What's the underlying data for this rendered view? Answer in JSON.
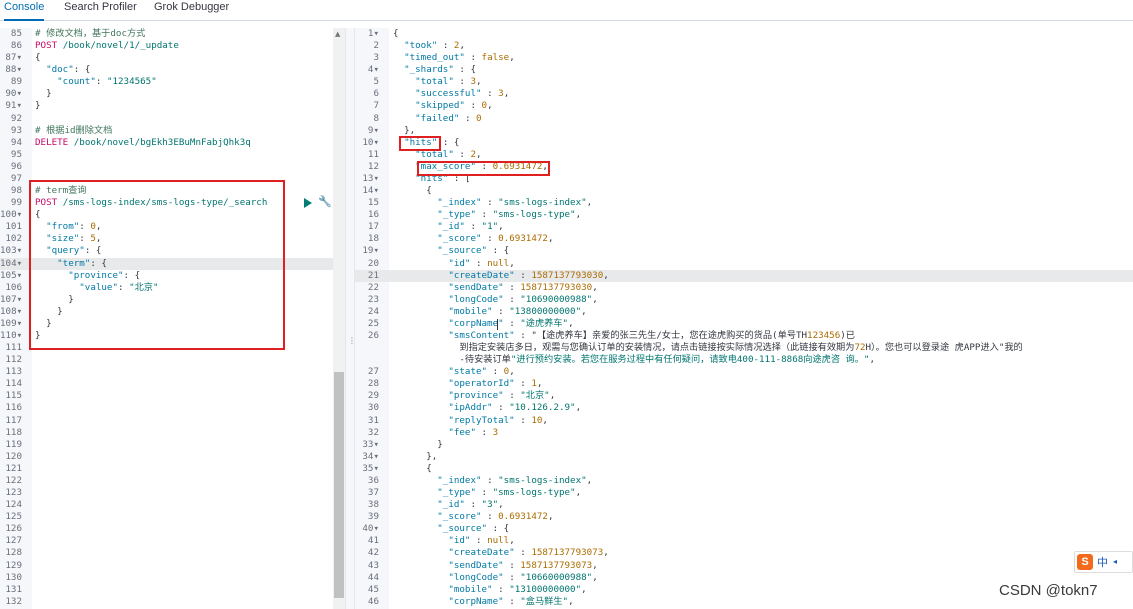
{
  "tabs": [
    {
      "label": "Console",
      "active": true
    },
    {
      "label": "Search Profiler",
      "active": false
    },
    {
      "label": "Grok Debugger",
      "active": false
    }
  ],
  "colors": {
    "accent": "#006bb4",
    "highlight_box": "#e02020",
    "method": "#c80a68",
    "string": "#00756f",
    "key": "#0079a5",
    "comment": "#41755c"
  },
  "icons": [
    "play-icon",
    "wrench-icon",
    "scroll-up-arrow",
    "sogou-ime-logo"
  ],
  "left_editor": {
    "lines": [
      {
        "n": "85",
        "fold": false,
        "text": "# 修改文档，基于doc方式"
      },
      {
        "n": "86",
        "fold": false,
        "text": "POST /book/novel/1/_update"
      },
      {
        "n": "87",
        "fold": true,
        "text": "{"
      },
      {
        "n": "88",
        "fold": true,
        "text": "  \"doc\": {"
      },
      {
        "n": "89",
        "fold": false,
        "text": "    \"count\": \"1234565\""
      },
      {
        "n": "90",
        "fold": true,
        "text": "  }"
      },
      {
        "n": "91",
        "fold": true,
        "text": "}"
      },
      {
        "n": "92",
        "fold": false,
        "text": ""
      },
      {
        "n": "93",
        "fold": false,
        "text": "# 根据id删除文档"
      },
      {
        "n": "94",
        "fold": false,
        "text": "DELETE /book/novel/bgEkh3EBuMnFabjQhk3q"
      },
      {
        "n": "95",
        "fold": false,
        "text": ""
      },
      {
        "n": "96",
        "fold": false,
        "text": ""
      },
      {
        "n": "97",
        "fold": false,
        "text": ""
      },
      {
        "n": "98",
        "fold": false,
        "text": "# term查询"
      },
      {
        "n": "99",
        "fold": false,
        "text": "POST /sms-logs-index/sms-logs-type/_search"
      },
      {
        "n": "100",
        "fold": true,
        "text": "{"
      },
      {
        "n": "101",
        "fold": false,
        "text": "  \"from\": 0,"
      },
      {
        "n": "102",
        "fold": false,
        "text": "  \"size\": 5,"
      },
      {
        "n": "103",
        "fold": true,
        "text": "  \"query\": {"
      },
      {
        "n": "104",
        "fold": true,
        "text": "    \"term\": {"
      },
      {
        "n": "105",
        "fold": true,
        "text": "      \"province\": {"
      },
      {
        "n": "106",
        "fold": false,
        "text": "        \"value\": \"北京\""
      },
      {
        "n": "107",
        "fold": true,
        "text": "      }"
      },
      {
        "n": "108",
        "fold": true,
        "text": "    }"
      },
      {
        "n": "109",
        "fold": true,
        "text": "  }"
      },
      {
        "n": "110",
        "fold": true,
        "text": "}"
      },
      {
        "n": "111",
        "fold": false,
        "text": ""
      },
      {
        "n": "112",
        "fold": false,
        "text": ""
      },
      {
        "n": "113",
        "fold": false,
        "text": ""
      },
      {
        "n": "114",
        "fold": false,
        "text": ""
      },
      {
        "n": "115",
        "fold": false,
        "text": ""
      },
      {
        "n": "116",
        "fold": false,
        "text": ""
      },
      {
        "n": "117",
        "fold": false,
        "text": ""
      },
      {
        "n": "118",
        "fold": false,
        "text": ""
      },
      {
        "n": "119",
        "fold": false,
        "text": ""
      },
      {
        "n": "120",
        "fold": false,
        "text": ""
      },
      {
        "n": "121",
        "fold": false,
        "text": ""
      },
      {
        "n": "122",
        "fold": false,
        "text": ""
      },
      {
        "n": "123",
        "fold": false,
        "text": ""
      },
      {
        "n": "124",
        "fold": false,
        "text": ""
      },
      {
        "n": "125",
        "fold": false,
        "text": ""
      },
      {
        "n": "126",
        "fold": false,
        "text": ""
      },
      {
        "n": "127",
        "fold": false,
        "text": ""
      },
      {
        "n": "128",
        "fold": false,
        "text": ""
      },
      {
        "n": "129",
        "fold": false,
        "text": ""
      },
      {
        "n": "130",
        "fold": false,
        "text": ""
      },
      {
        "n": "131",
        "fold": false,
        "text": ""
      },
      {
        "n": "132",
        "fold": false,
        "text": ""
      }
    ]
  },
  "right_editor": {
    "lines": [
      {
        "n": "1",
        "fold": true,
        "text": "{"
      },
      {
        "n": "2",
        "fold": false,
        "text": "  \"took\" : 2,"
      },
      {
        "n": "3",
        "fold": false,
        "text": "  \"timed_out\" : false,"
      },
      {
        "n": "4",
        "fold": true,
        "text": "  \"_shards\" : {"
      },
      {
        "n": "5",
        "fold": false,
        "text": "    \"total\" : 3,"
      },
      {
        "n": "6",
        "fold": false,
        "text": "    \"successful\" : 3,"
      },
      {
        "n": "7",
        "fold": false,
        "text": "    \"skipped\" : 0,"
      },
      {
        "n": "8",
        "fold": false,
        "text": "    \"failed\" : 0"
      },
      {
        "n": "9",
        "fold": true,
        "text": "  },"
      },
      {
        "n": "10",
        "fold": true,
        "text": "  \"hits\" : {"
      },
      {
        "n": "11",
        "fold": false,
        "text": "    \"total\" : 2,"
      },
      {
        "n": "12",
        "fold": false,
        "text": "    \"max_score\" : 0.6931472,"
      },
      {
        "n": "13",
        "fold": true,
        "text": "    \"hits\" : ["
      },
      {
        "n": "14",
        "fold": true,
        "text": "      {"
      },
      {
        "n": "15",
        "fold": false,
        "text": "        \"_index\" : \"sms-logs-index\","
      },
      {
        "n": "16",
        "fold": false,
        "text": "        \"_type\" : \"sms-logs-type\","
      },
      {
        "n": "17",
        "fold": false,
        "text": "        \"_id\" : \"1\","
      },
      {
        "n": "18",
        "fold": false,
        "text": "        \"_score\" : 0.6931472,"
      },
      {
        "n": "19",
        "fold": true,
        "text": "        \"_source\" : {"
      },
      {
        "n": "20",
        "fold": false,
        "text": "          \"id\" : null,"
      },
      {
        "n": "21",
        "fold": false,
        "text": "          \"createDate\" : 1587137793030,"
      },
      {
        "n": "22",
        "fold": false,
        "text": "          \"sendDate\" : 1587137793030,"
      },
      {
        "n": "23",
        "fold": false,
        "text": "          \"longCode\" : \"10690000988\","
      },
      {
        "n": "24",
        "fold": false,
        "text": "          \"mobile\" : \"13800000000\","
      },
      {
        "n": "25",
        "fold": false,
        "text": "          \"corpName\" : \"途虎养车\","
      },
      {
        "n": "26",
        "fold": false,
        "text": "          \"smsContent\" : \"【途虎养车】亲爱的张三先生/女士，您在途虎购买的货品(单号TH123456)已"
      },
      {
        "n": "",
        "fold": false,
        "text": "            到指定安装店多日，观需与您确认订单的安装情况，请点击链接按实际情况选择（此链接有效期为72H）。您也可以登录途 虎APP进入\"我的"
      },
      {
        "n": "",
        "fold": false,
        "text": "            -待安装订单\"进行预约安装。若您在服务过程中有任何疑问，请致电400-111-8868向途虎咨 询。\","
      },
      {
        "n": "27",
        "fold": false,
        "text": "          \"state\" : 0,"
      },
      {
        "n": "28",
        "fold": false,
        "text": "          \"operatorId\" : 1,"
      },
      {
        "n": "29",
        "fold": false,
        "text": "          \"province\" : \"北京\","
      },
      {
        "n": "30",
        "fold": false,
        "text": "          \"ipAddr\" : \"10.126.2.9\","
      },
      {
        "n": "31",
        "fold": false,
        "text": "          \"replyTotal\" : 10,"
      },
      {
        "n": "32",
        "fold": false,
        "text": "          \"fee\" : 3"
      },
      {
        "n": "33",
        "fold": true,
        "text": "        }"
      },
      {
        "n": "34",
        "fold": true,
        "text": "      },"
      },
      {
        "n": "35",
        "fold": true,
        "text": "      {"
      },
      {
        "n": "36",
        "fold": false,
        "text": "        \"_index\" : \"sms-logs-index\","
      },
      {
        "n": "37",
        "fold": false,
        "text": "        \"_type\" : \"sms-logs-type\","
      },
      {
        "n": "38",
        "fold": false,
        "text": "        \"_id\" : \"3\","
      },
      {
        "n": "39",
        "fold": false,
        "text": "        \"_score\" : 0.6931472,"
      },
      {
        "n": "40",
        "fold": true,
        "text": "        \"_source\" : {"
      },
      {
        "n": "41",
        "fold": false,
        "text": "          \"id\" : null,"
      },
      {
        "n": "42",
        "fold": false,
        "text": "          \"createDate\" : 1587137793073,"
      },
      {
        "n": "43",
        "fold": false,
        "text": "          \"sendDate\" : 1587137793073,"
      },
      {
        "n": "44",
        "fold": false,
        "text": "          \"longCode\" : \"10660000988\","
      },
      {
        "n": "45",
        "fold": false,
        "text": "          \"mobile\" : \"13100000000\","
      },
      {
        "n": "46",
        "fold": false,
        "text": "          \"corpName\" : \"盒马鲜生\","
      }
    ]
  },
  "ime": {
    "logo": "S",
    "lang": "中",
    "arrow": "◂"
  },
  "watermark": "CSDN @tokn7"
}
